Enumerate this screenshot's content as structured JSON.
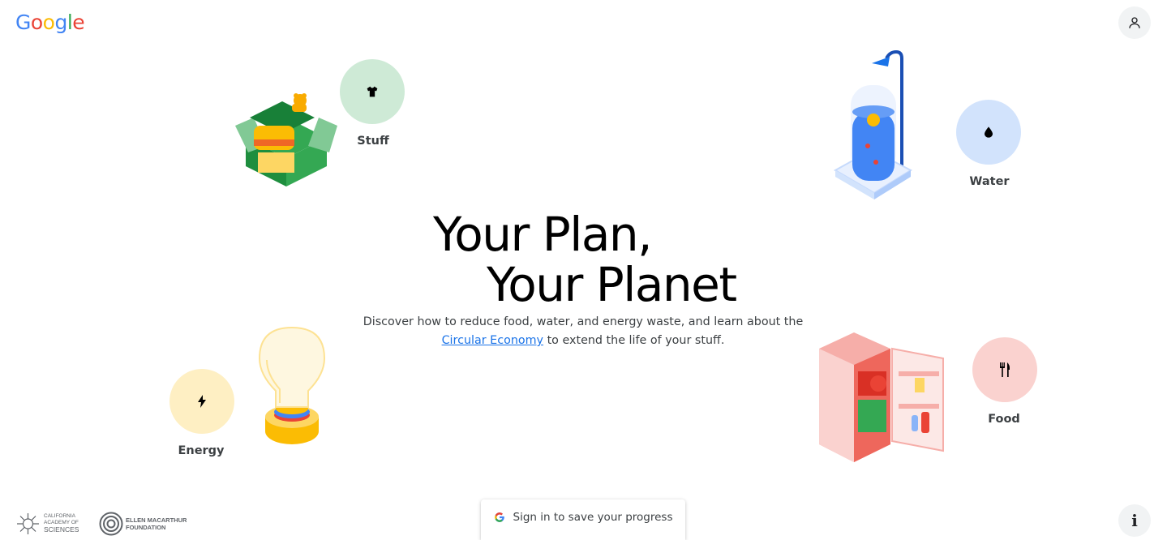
{
  "header": {
    "logo": "Google",
    "account_icon": "person-outline-icon"
  },
  "categories": {
    "stuff": {
      "label": "Stuff",
      "icon": "t-shirt-icon",
      "color": "#ceead6"
    },
    "water": {
      "label": "Water",
      "icon": "water-drop-icon",
      "color": "#d2e3fc"
    },
    "energy": {
      "label": "Energy",
      "icon": "lightning-bolt-icon",
      "color": "#feefc3"
    },
    "food": {
      "label": "Food",
      "icon": "fork-knife-icon",
      "color": "#fad2cf"
    }
  },
  "hero": {
    "title_line1": "Your Plan,",
    "title_line2": "Your Planet",
    "desc_before": "Discover how to reduce food, water, and energy waste, and learn about the",
    "desc_link": "Circular Economy",
    "desc_after": "to extend the life of your stuff."
  },
  "footer": {
    "signin_label": "Sign in to save your progress",
    "info_label": "i",
    "partners": {
      "cas_line1": "CALIFORNIA",
      "cas_line2": "ACADEMY OF",
      "cas_line3": "SCIENCES",
      "emf_line1": "ELLEN MACARTHUR",
      "emf_line2": "FOUNDATION"
    }
  },
  "colors": {
    "link": "#1a73e8",
    "text": "#3c4043"
  }
}
